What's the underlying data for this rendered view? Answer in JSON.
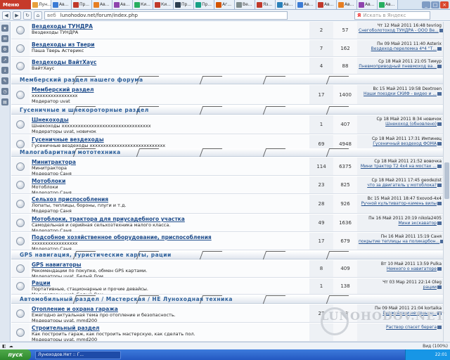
{
  "browser": {
    "menu_label": "Меню",
    "active_tab": "Лун...",
    "tabs": [
      "Ав...",
      "Пр...",
      "Ав...",
      "Ав...",
      "Ки...",
      "Ки...",
      "Пр...",
      "Пр...",
      "Аг...",
      "Ве...",
      "Яз...",
      "Ав...",
      "Ав...",
      "Ав...",
      "Ав...",
      "Ав...",
      "Ав..."
    ],
    "url_prefix": "веб",
    "url": "lunohodov.net/forum/index.php",
    "search_placeholder": "Искать в Яндекс",
    "search_brand": "Я",
    "zoom": "Вид (100%)"
  },
  "categories": [
    {
      "title": "Мемберский раздел нашего форума"
    },
    {
      "title": "Гусеничные и шнекороторные раздел"
    },
    {
      "title": "Малогабаритная мототехника"
    },
    {
      "title": "GPS навигация, туристические карты, рации"
    },
    {
      "title": "Автомобильный раздел / Мастерская / НЕ Луноходная техника"
    }
  ],
  "forums": [
    {
      "title": "Вездеходы ТУНДРА",
      "desc": "Вездеходы ТУНДРА",
      "mods": "",
      "topics": "2",
      "posts": "57",
      "date": "Чт 12 Май 2011 16:48 tevriog",
      "last": "Снегоболотоход ТУНДРА - ООО Ве..."
    },
    {
      "title": "Вездеходы из Твери",
      "desc": "Паша Тверь Астерикс",
      "mods": "",
      "topics": "7",
      "posts": "162",
      "date": "Пн 09 Май 2011 11:40 Asterix",
      "last": "Вездеход-переломка 4*4 \"Т..."
    },
    {
      "title": "Вездеходы ВайтХаус",
      "desc": "ВайтХаус",
      "mods": "",
      "topics": "4",
      "posts": "88",
      "date": "Ср 18 Май 2011 21:05 Тимур",
      "last": "Пневмоприводный пневмоход ва..."
    },
    {
      "title": "Мемберский раздел",
      "desc": "xxxxxxxxxxxxxxxxx",
      "mods": "Модератор uvat",
      "topics": "17",
      "posts": "1400",
      "date": "Вс 15 Май 2011 19:58 Dextroen",
      "last": "Наши поездки СКИФ - видео и ..."
    },
    {
      "title": "Шнекоходы",
      "desc": "Шнекоходы xxxxxxxxxxxxxxxxxxxxxxxxxxxxxxxxx",
      "mods": "Модераторы uvat, новичок",
      "topics": "1",
      "posts": "407",
      "date": "Ср 18 Май 2011 8:34 новичок",
      "last": "Шнекоход (обновлено)"
    },
    {
      "title": "Гусеничные вездеходы",
      "desc": "Гусеничные вездеходы xxxxxxxxxxxxxxxxxxxxxxxxxxxx",
      "mods": "Модераторы uvat, новичок",
      "topics": "69",
      "posts": "4948",
      "date": "Ср 18 Май 2011 17:31 Импинец",
      "last": "Гусеничный вездеход ФОМА"
    },
    {
      "title": "Минитрактора",
      "desc": "Минитрактора",
      "mods": "Модератор Саня",
      "topics": "114",
      "posts": "6375",
      "date": "Ср 18 Май 2011 21:52 вовочка",
      "last": "Мини трактор Т2 4х4 на мостах ..."
    },
    {
      "title": "Мотоблоки",
      "desc": "Мотоблоки",
      "mods": "Модератор Саня",
      "topics": "23",
      "posts": "825",
      "date": "Ср 18 Май 2011 17:45 geodezist",
      "last": "что за двигатель у мотоблока?"
    },
    {
      "title": "Сельхоз приспособления",
      "desc": "Лопаты, теплицы, бороны, плуги и т.д.",
      "mods": "Модератор Саня",
      "topics": "28",
      "posts": "926",
      "date": "Вс 15 Май 2011 18:47 tixovod-4x4",
      "last": "Ручной культиватор-камень вилы"
    },
    {
      "title": "Мотоблоки, трактора для приусадебного участка",
      "desc": "Самодельная и серийная сельхозтехника малого класса.",
      "mods": "Модератор Саня",
      "topics": "49",
      "posts": "1636",
      "date": "Пн 16 Май 2011 20:19 nikola2405",
      "last": "Мини экскаватор"
    },
    {
      "title": "Подсобное хозяйственное оборудование, приспособления",
      "desc": "xxxxxxxxxxxxxxxxx",
      "mods": "Модератор Саня",
      "topics": "17",
      "posts": "679",
      "date": "Пн 16 Май 2011 15:19 Саня",
      "last": "покрытие теплицы на поликарбон..."
    },
    {
      "title": "GPS навигаторы",
      "desc": "Рекомендации по покупке, обмен GPS картами.",
      "mods": "Модераторы uvat, Белый Дом",
      "topics": "8",
      "posts": "409",
      "date": "Вт 10 Май 2011 13:59 Pulka",
      "last": "Немного о навигаторе"
    },
    {
      "title": "Рации",
      "desc": "Портативные, стационарные и прочие девайсы.",
      "mods": "Модераторы uvat, Белый Дом",
      "topics": "1",
      "posts": "138",
      "date": "Чт 03 Мар 2011 22:14 Oleg",
      "last": "рации"
    },
    {
      "title": "Отопление и охрана гаража",
      "desc": "Ежегодно актуальная тема про отопление и безопасность.",
      "mods": "Модераторы uvat, mmd200",
      "topics": "27",
      "posts": "13",
      "date": "Пн 09 Май 2011 21:04 kortaika",
      "last": "Буржуйки и не только..."
    },
    {
      "title": "Строительный раздел",
      "desc": "Как построить гараж, как построить мастерскую, как сделать пол.",
      "mods": "Модераторы uvat, mmd200",
      "topics": "",
      "posts": "",
      "date": "",
      "last": "Раствор спасет берега"
    }
  ],
  "watermark": "LUNOHODOV.NET",
  "taskbar": {
    "start": "пуск",
    "task": "Луноходов.Нет :: Г...",
    "clock": "22:01"
  }
}
